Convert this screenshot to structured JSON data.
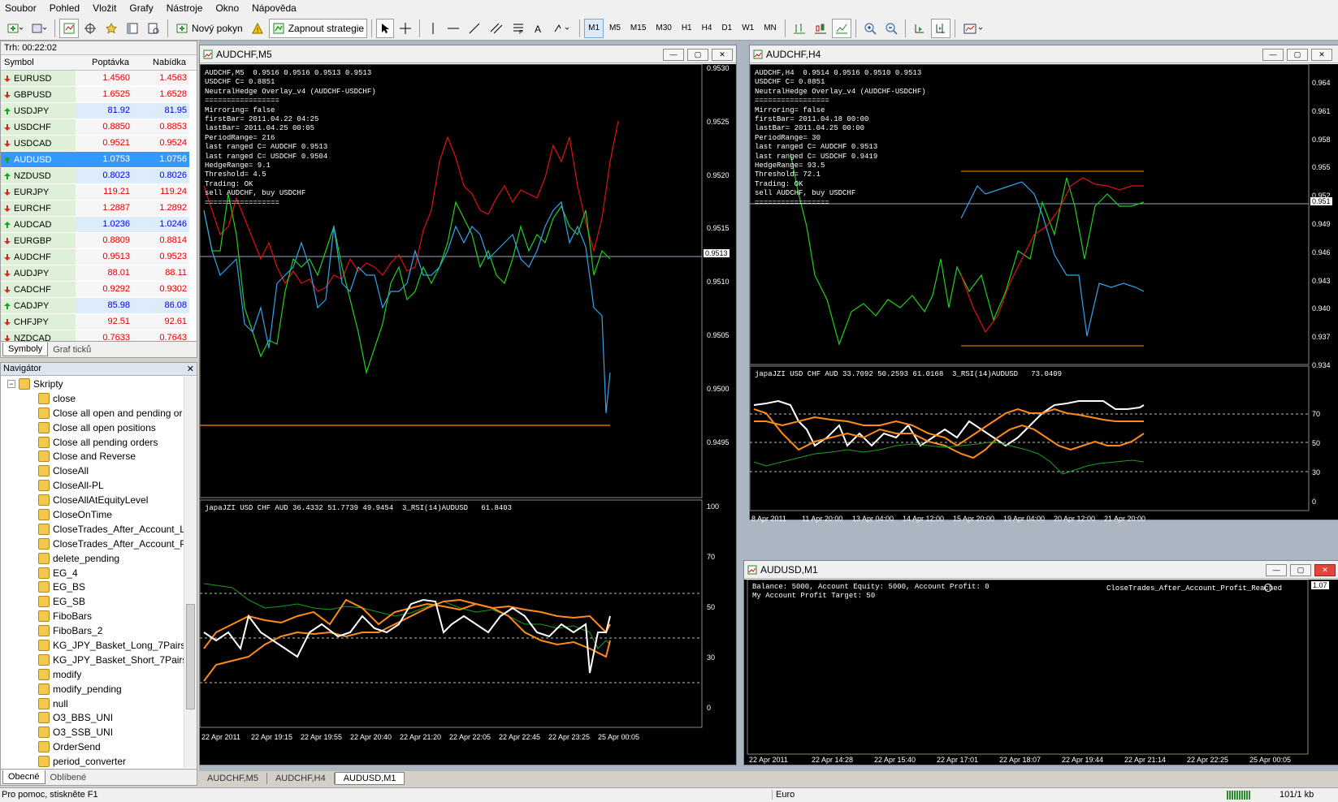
{
  "menu": [
    "Soubor",
    "Pohled",
    "Vložit",
    "Grafy",
    "Nástroje",
    "Okno",
    "Nápověda"
  ],
  "toolbar": {
    "new_order": "Nový pokyn",
    "strategy": "Zapnout strategie",
    "timeframes": [
      "M1",
      "M5",
      "M15",
      "M30",
      "H1",
      "H4",
      "D1",
      "W1",
      "MN"
    ],
    "active_timeframe": "M1"
  },
  "market_watch": {
    "title": "Trh: 00:22:02",
    "headers": [
      "Symbol",
      "Poptávka",
      "Nabídka"
    ],
    "rows": [
      {
        "symbol": "EURUSD",
        "bid": "1.4560",
        "ask": "1.4563",
        "dir": "down"
      },
      {
        "symbol": "GBPUSD",
        "bid": "1.6525",
        "ask": "1.6528",
        "dir": "down"
      },
      {
        "symbol": "USDJPY",
        "bid": "81.92",
        "ask": "81.95",
        "dir": "up"
      },
      {
        "symbol": "USDCHF",
        "bid": "0.8850",
        "ask": "0.8853",
        "dir": "down"
      },
      {
        "symbol": "USDCAD",
        "bid": "0.9521",
        "ask": "0.9524",
        "dir": "down"
      },
      {
        "symbol": "AUDUSD",
        "bid": "1.0753",
        "ask": "1.0756",
        "dir": "up",
        "selected": true
      },
      {
        "symbol": "NZDUSD",
        "bid": "0.8023",
        "ask": "0.8026",
        "dir": "up"
      },
      {
        "symbol": "EURJPY",
        "bid": "119.21",
        "ask": "119.24",
        "dir": "down"
      },
      {
        "symbol": "EURCHF",
        "bid": "1.2887",
        "ask": "1.2892",
        "dir": "down"
      },
      {
        "symbol": "AUDCAD",
        "bid": "1.0236",
        "ask": "1.0246",
        "dir": "up"
      },
      {
        "symbol": "EURGBP",
        "bid": "0.8809",
        "ask": "0.8814",
        "dir": "down"
      },
      {
        "symbol": "AUDCHF",
        "bid": "0.9513",
        "ask": "0.9523",
        "dir": "down"
      },
      {
        "symbol": "AUDJPY",
        "bid": "88.01",
        "ask": "88.11",
        "dir": "down"
      },
      {
        "symbol": "CADCHF",
        "bid": "0.9292",
        "ask": "0.9302",
        "dir": "down"
      },
      {
        "symbol": "CADJPY",
        "bid": "85.98",
        "ask": "86.08",
        "dir": "up"
      },
      {
        "symbol": "CHFJPY",
        "bid": "92.51",
        "ask": "92.61",
        "dir": "down"
      },
      {
        "symbol": "NZDCAD",
        "bid": "0.7633",
        "ask": "0.7643",
        "dir": "down"
      }
    ],
    "tabs": [
      "Symboly",
      "Graf ticků"
    ]
  },
  "navigator": {
    "title": "Navigátor",
    "root": "Skripty",
    "items": [
      "close",
      "Close all open and pending or",
      "Close all open positions",
      "Close all pending orders",
      "Close and Reverse",
      "CloseAll",
      "CloseAll-PL",
      "CloseAllAtEquityLevel",
      "CloseOnTime",
      "CloseTrades_After_Account_L",
      "CloseTrades_After_Account_P",
      "delete_pending",
      "EG_4",
      "EG_BS",
      "EG_SB",
      "FiboBars",
      "FiboBars_2",
      "KG_JPY_Basket_Long_7Pairs",
      "KG_JPY_Basket_Short_7Pairs",
      "modify",
      "modify_pending",
      "null",
      "O3_BBS_UNI",
      "O3_SSB_UNI",
      "OrderSend",
      "period_converter"
    ],
    "tabs": [
      "Obecné",
      "Oblíbené"
    ]
  },
  "windows": {
    "w1": {
      "title": "AUDCHF,M5",
      "info": "AUDCHF,M5  0.9516 0.9516 0.9513 0.9513\nUSDCHF C= 0.8851\nNeutralHedge Overlay_v4 (AUDCHF-USDCHF)\n=================\nMirroring= false\nfirstBar= 2011.04.22 04:25\nlastBar= 2011.04.25 00:05\nPeriodRange= 216\nlast ranged C= AUDCHF 0.9513\nlast ranged C= USDCHF 0.9504\nHedgeRange= 9.1\nThreshold= 4.5\nTrading: OK\nsell AUDCHF, buy USDCHF\n=================",
      "price_labels": [
        "0.9530",
        "0.9525",
        "0.9520",
        "0.9515",
        "0.9510",
        "0.9505",
        "0.9500",
        "0.9495"
      ],
      "current_price": "0.9513",
      "sub_label": "japaJZI USD CHF AUD 36.4332 51.7739 49.9454  3_RSI(14)AUDUSD   61.8403",
      "sub_levels": [
        "100",
        "70",
        "50",
        "30",
        "0"
      ],
      "time_labels": [
        "22 Apr 2011",
        "22 Apr 19:15",
        "22 Apr 19:55",
        "22 Apr 20:40",
        "22 Apr 21:20",
        "22 Apr 22:05",
        "22 Apr 22:45",
        "22 Apr 23:25",
        "25 Apr 00:05"
      ]
    },
    "w2": {
      "title": "AUDCHF,H4",
      "info": "AUDCHF,H4  0.9514 0.9516 0.9510 0.9513\nUSDCHF C= 0.8851\nNeutralHedge Overlay_v4 (AUDCHF-USDCHF)\n=================\nMirroring= false\nfirstBar= 2011.04.18 00:00\nlastBar= 2011.04.25 00:00\nPeriodRange= 30\nlast ranged C= AUDCHF 0.9513\nlast ranged C= USDCHF 0.9419\nHedgeRange= 93.5\nThreshold= 72.1\nTrading: OK\nsell AUDCHF, buy USDCHF\n=================",
      "price_labels": [
        "0.964",
        "0.961",
        "0.958",
        "0.955",
        "0.952",
        "0.949",
        "0.946",
        "0.943",
        "0.940",
        "0.937",
        "0.934"
      ],
      "current_price": "0.951",
      "sub_label": "japaJZI USD CHF AUD 33.7092 50.2593 61.0168  3_RSI(14)AUDUSD   73.0409",
      "sub_levels": [
        "70",
        "50",
        "30",
        "0"
      ],
      "time_labels": [
        "8 Apr 2011",
        "11 Apr 20:00",
        "13 Apr 04:00",
        "14 Apr 12:00",
        "15 Apr 20:00",
        "19 Apr 04:00",
        "20 Apr 12:00",
        "21 Apr 20:00"
      ]
    },
    "w3": {
      "title": "AUDUSD,M1",
      "line1": "Balance: 5000, Account Equity: 5000, Account Profit: 0",
      "line2": "My Account Profit Target: 50",
      "ea": "CloseTrades_After_Account_Profit_Reached",
      "price_label": "1.07",
      "time_labels": [
        "22 Apr 2011",
        "22 Apr 14:28",
        "22 Apr 15:40",
        "22 Apr 17:01",
        "22 Apr 18:07",
        "22 Apr 19:44",
        "22 Apr 21:14",
        "22 Apr 22:25",
        "25 Apr 00:05"
      ]
    }
  },
  "bottom_tabs": [
    "AUDCHF,M5",
    "AUDCHF,H4",
    "AUDUSD,M1"
  ],
  "status": {
    "help": "Pro pomoc, stiskněte F1",
    "profile": "Euro",
    "traffic": "101/1 kb"
  }
}
